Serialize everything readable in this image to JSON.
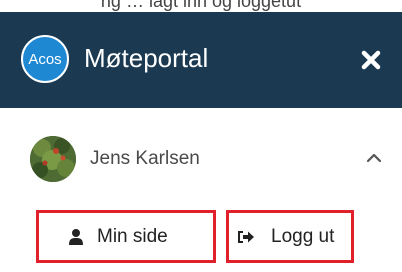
{
  "header": {
    "logo_text": "Acos",
    "title": "Møteportal",
    "close_icon": "close-x-icon",
    "bg_color": "#1b3a52",
    "logo_color": "#1f88d2"
  },
  "top_cut_text": "ng … lagt inn og loggetut",
  "user": {
    "name": "Jens Karlsen",
    "avatar_icon": "user-photo-avatar",
    "toggle_icon": "chevron-up-icon"
  },
  "actions": {
    "my_page_label": "Min side",
    "my_page_icon": "user-icon",
    "logout_label": "Logg ut",
    "logout_icon": "sign-out-icon"
  },
  "highlight_color": "#e0202a"
}
